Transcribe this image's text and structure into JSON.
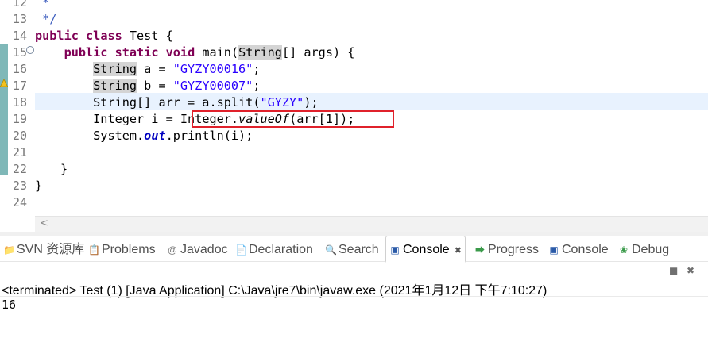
{
  "editor": {
    "line_numbers": [
      "12",
      "13",
      "14",
      "15",
      "16",
      "17",
      "18",
      "19",
      "20",
      "21",
      "22",
      "23",
      "24"
    ],
    "lines": {
      "l12": " *",
      "l13": " */",
      "l14_kw1": "public",
      "l14_kw2": "class",
      "l14_rest": " Test {",
      "l15_kw1": "public",
      "l15_kw2": "static",
      "l15_kw3": "void",
      "l15_name": " main(",
      "l15_type": "String",
      "l15_rest": "[] args) {",
      "l16_type": "String",
      "l16_mid": " a = ",
      "l16_str": "\"GYZY00016\"",
      "l16_end": ";",
      "l17_type": "String",
      "l17_mid": " b = ",
      "l17_str": "\"GYZY00007\"",
      "l17_end": ";",
      "l18_pre": "String[] arr = a.split(",
      "l18_str": "\"GYZY\"",
      "l18_end": ");",
      "l19_pre": "Integer i = ",
      "l19_cls": "Integer.",
      "l19_meth": "valueOf",
      "l19_end": "(arr[1]);",
      "l20_pre": "System.",
      "l20_field": "out",
      "l20_end": ".println(i);",
      "l22": "}",
      "l23": "}"
    },
    "fold_marker": "⊖",
    "scroll_left_arrow": "<"
  },
  "tabs": {
    "items": [
      {
        "label": "SVN 资源库",
        "icon": "svn-repository-icon",
        "glyph": "📁"
      },
      {
        "label": "Problems",
        "icon": "problems-icon",
        "glyph": "📋"
      },
      {
        "label": "Javadoc",
        "icon": "javadoc-icon",
        "glyph": "@"
      },
      {
        "label": "Declaration",
        "icon": "declaration-icon",
        "glyph": "📄"
      },
      {
        "label": "Search",
        "icon": "search-icon",
        "glyph": "🔍"
      },
      {
        "label": "Console",
        "icon": "console-icon",
        "glyph": "▣"
      },
      {
        "label": "Progress",
        "icon": "progress-icon",
        "glyph": "⮕"
      },
      {
        "label": "Console",
        "icon": "console-icon",
        "glyph": "▣"
      },
      {
        "label": "Debug",
        "icon": "debug-icon",
        "glyph": "❀"
      }
    ],
    "close_glyph": "✖"
  },
  "console": {
    "status": "<terminated> Test (1) [Java Application] C:\\Java\\jre7\\bin\\javaw.exe (2021年1月12日 下午7:10:27)",
    "output": "16",
    "terminate_glyph": "■",
    "remove_glyph": "✖"
  }
}
